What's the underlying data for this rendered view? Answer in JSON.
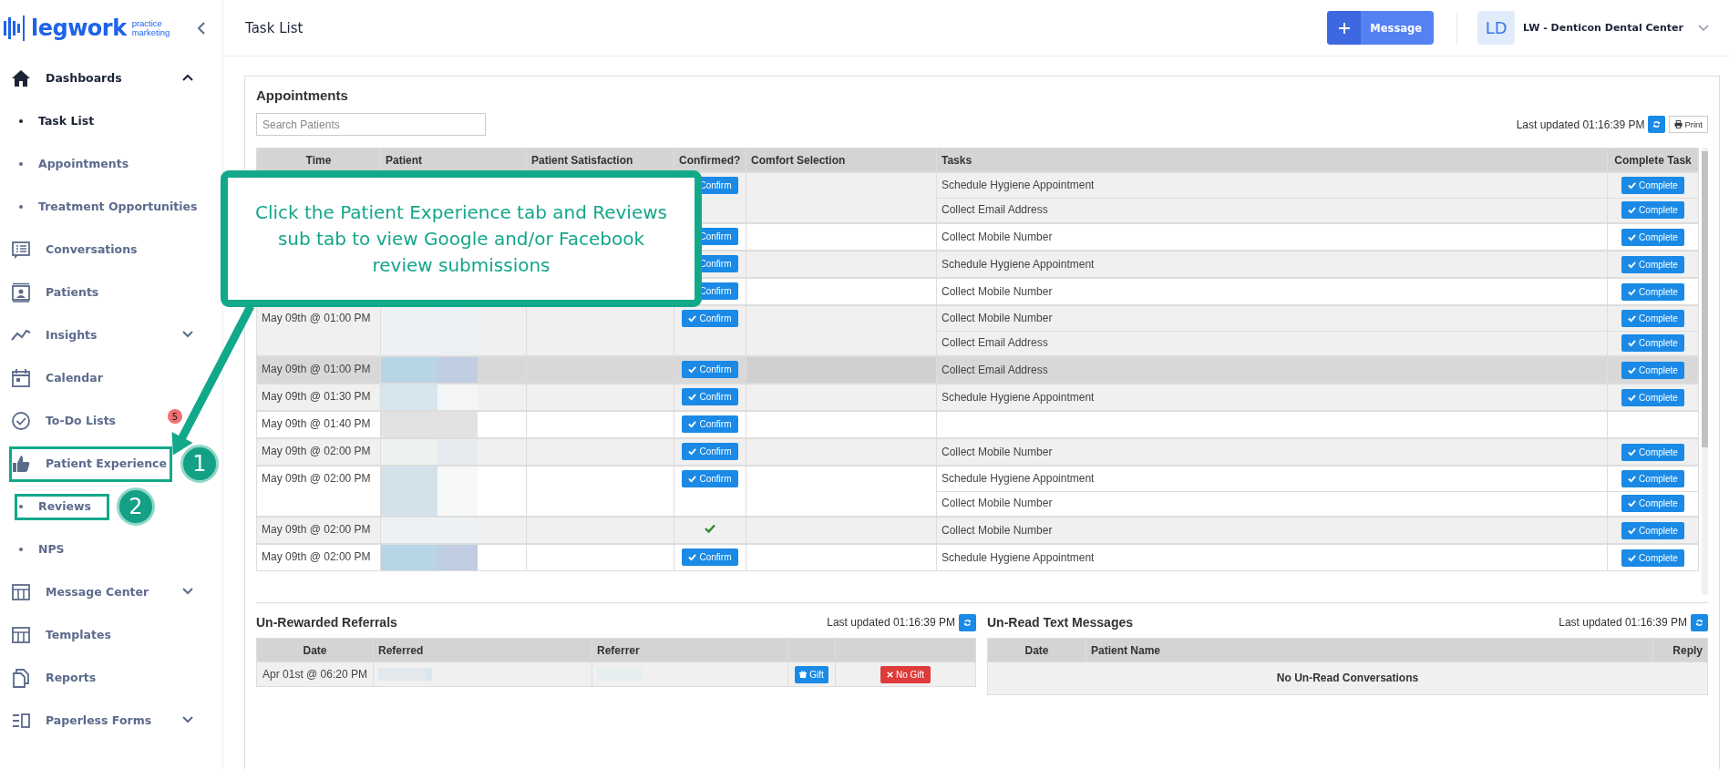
{
  "logo": {
    "name": "legwork",
    "tagline": "practice marketing"
  },
  "sidebar": {
    "items": [
      {
        "label": "Dashboards",
        "selected": true,
        "expanded": true,
        "children": [
          {
            "label": "Task List",
            "selected": true
          },
          {
            "label": "Appointments",
            "selected": false
          },
          {
            "label": "Treatment Opportunities",
            "selected": false
          }
        ]
      },
      {
        "label": "Conversations",
        "selected": false
      },
      {
        "label": "Patients",
        "selected": false
      },
      {
        "label": "Insights",
        "selected": false,
        "expanded": false
      },
      {
        "label": "Calendar",
        "selected": false
      },
      {
        "label": "To-Do Lists",
        "selected": false,
        "badge": "5"
      },
      {
        "label": "Patient Experience",
        "selected": false,
        "children": [
          {
            "label": "Reviews",
            "selected": false
          },
          {
            "label": "NPS",
            "selected": false
          }
        ]
      },
      {
        "label": "Message Center",
        "selected": false,
        "expanded": false
      },
      {
        "label": "Templates",
        "selected": false
      },
      {
        "label": "Reports",
        "selected": false
      },
      {
        "label": "Paperless Forms",
        "selected": false,
        "expanded": false
      }
    ]
  },
  "header": {
    "title": "Task List",
    "message_button": "Message",
    "avatar": "LD",
    "account": "LW - Denticon Dental Center"
  },
  "appointments": {
    "title": "Appointments",
    "search": {
      "placeholder": "Search Patients"
    },
    "last_updated": "Last updated 01:16:39 PM",
    "print_button": "Print",
    "columns": [
      "Time",
      "Patient",
      "Patient Satisfaction",
      "Confirmed?",
      "Comfort Selection",
      "Tasks",
      "Complete Task"
    ],
    "rows": [
      {
        "highlighted": false,
        "confirmed": false,
        "confirm_label": "Confirm",
        "tasks": [
          {
            "label": "Schedule Hygiene Appointment",
            "button": "Complete"
          },
          {
            "label": "Collect Email Address",
            "button": "Complete"
          }
        ]
      },
      {
        "highlighted": false,
        "confirmed": false,
        "confirm_label": "Confirm",
        "tasks": [
          {
            "label": "Collect Mobile Number",
            "button": "Complete"
          }
        ]
      },
      {
        "highlighted": false,
        "confirmed": false,
        "confirm_label": "Confirm",
        "tasks": [
          {
            "label": "Schedule Hygiene Appointment",
            "button": "Complete"
          }
        ]
      },
      {
        "highlighted": false,
        "confirmed": false,
        "confirm_label": "Confirm",
        "tasks": [
          {
            "label": "Collect Mobile Number",
            "button": "Complete"
          }
        ]
      },
      {
        "time": "May 09th @ 01:00 PM",
        "highlighted": false,
        "confirmed": false,
        "confirm_label": "Confirm",
        "tasks": [
          {
            "label": "Collect Mobile Number",
            "button": "Complete"
          },
          {
            "label": "Collect Email Address",
            "button": "Complete"
          }
        ]
      },
      {
        "time": "May 09th @ 01:00 PM",
        "highlighted": true,
        "confirmed": false,
        "confirm_label": "Confirm",
        "tasks": [
          {
            "label": "Collect Email Address",
            "button": "Complete"
          }
        ]
      },
      {
        "time": "May 09th @ 01:30 PM",
        "highlighted": false,
        "confirmed": false,
        "confirm_label": "Confirm",
        "tasks": [
          {
            "label": "Schedule Hygiene Appointment",
            "button": "Complete"
          }
        ]
      },
      {
        "time": "May 09th @ 01:40 PM",
        "highlighted": false,
        "confirmed": false,
        "confirm_label": "Confirm"
      },
      {
        "time": "May 09th @ 02:00 PM",
        "highlighted": false,
        "confirmed": false,
        "confirm_label": "Confirm",
        "tasks": [
          {
            "label": "Collect Mobile Number",
            "button": "Complete"
          }
        ]
      },
      {
        "time": "May 09th @ 02:00 PM",
        "highlighted": false,
        "confirmed": false,
        "confirm_label": "Confirm",
        "tasks": [
          {
            "label": "Schedule Hygiene Appointment",
            "button": "Complete"
          },
          {
            "label": "Collect Mobile Number",
            "button": "Complete"
          }
        ]
      },
      {
        "time": "May 09th @ 02:00 PM",
        "highlighted": false,
        "confirmed": true,
        "tasks": [
          {
            "label": "Collect Mobile Number",
            "button": "Complete"
          }
        ]
      },
      {
        "time": "May 09th @ 02:00 PM",
        "highlighted": false,
        "confirmed": false,
        "confirm_label": "Confirm",
        "tasks": [
          {
            "label": "Schedule Hygiene Appointment",
            "button": "Complete"
          }
        ]
      }
    ]
  },
  "referrals": {
    "title": "Un-Rewarded Referrals",
    "last_updated": "Last updated 01:16:39 PM",
    "columns": [
      "Date",
      "Referred",
      "Referrer"
    ],
    "rows": [
      {
        "date": "Apr 01st @ 06:20 PM",
        "gift_button": "Gift",
        "no_gift_button": "No Gift"
      }
    ]
  },
  "messages": {
    "title": "Un-Read Text Messages",
    "last_updated": "Last updated 01:16:39 PM",
    "columns": [
      "Date",
      "Patient Name",
      "Reply"
    ],
    "empty_text": "No Un-Read Conversations"
  },
  "annotation": {
    "callout": "Click the Patient Experience tab and Reviews sub tab to view Google and/or Facebook review submissions",
    "markers": [
      {
        "label": "1"
      },
      {
        "label": "2"
      }
    ]
  }
}
